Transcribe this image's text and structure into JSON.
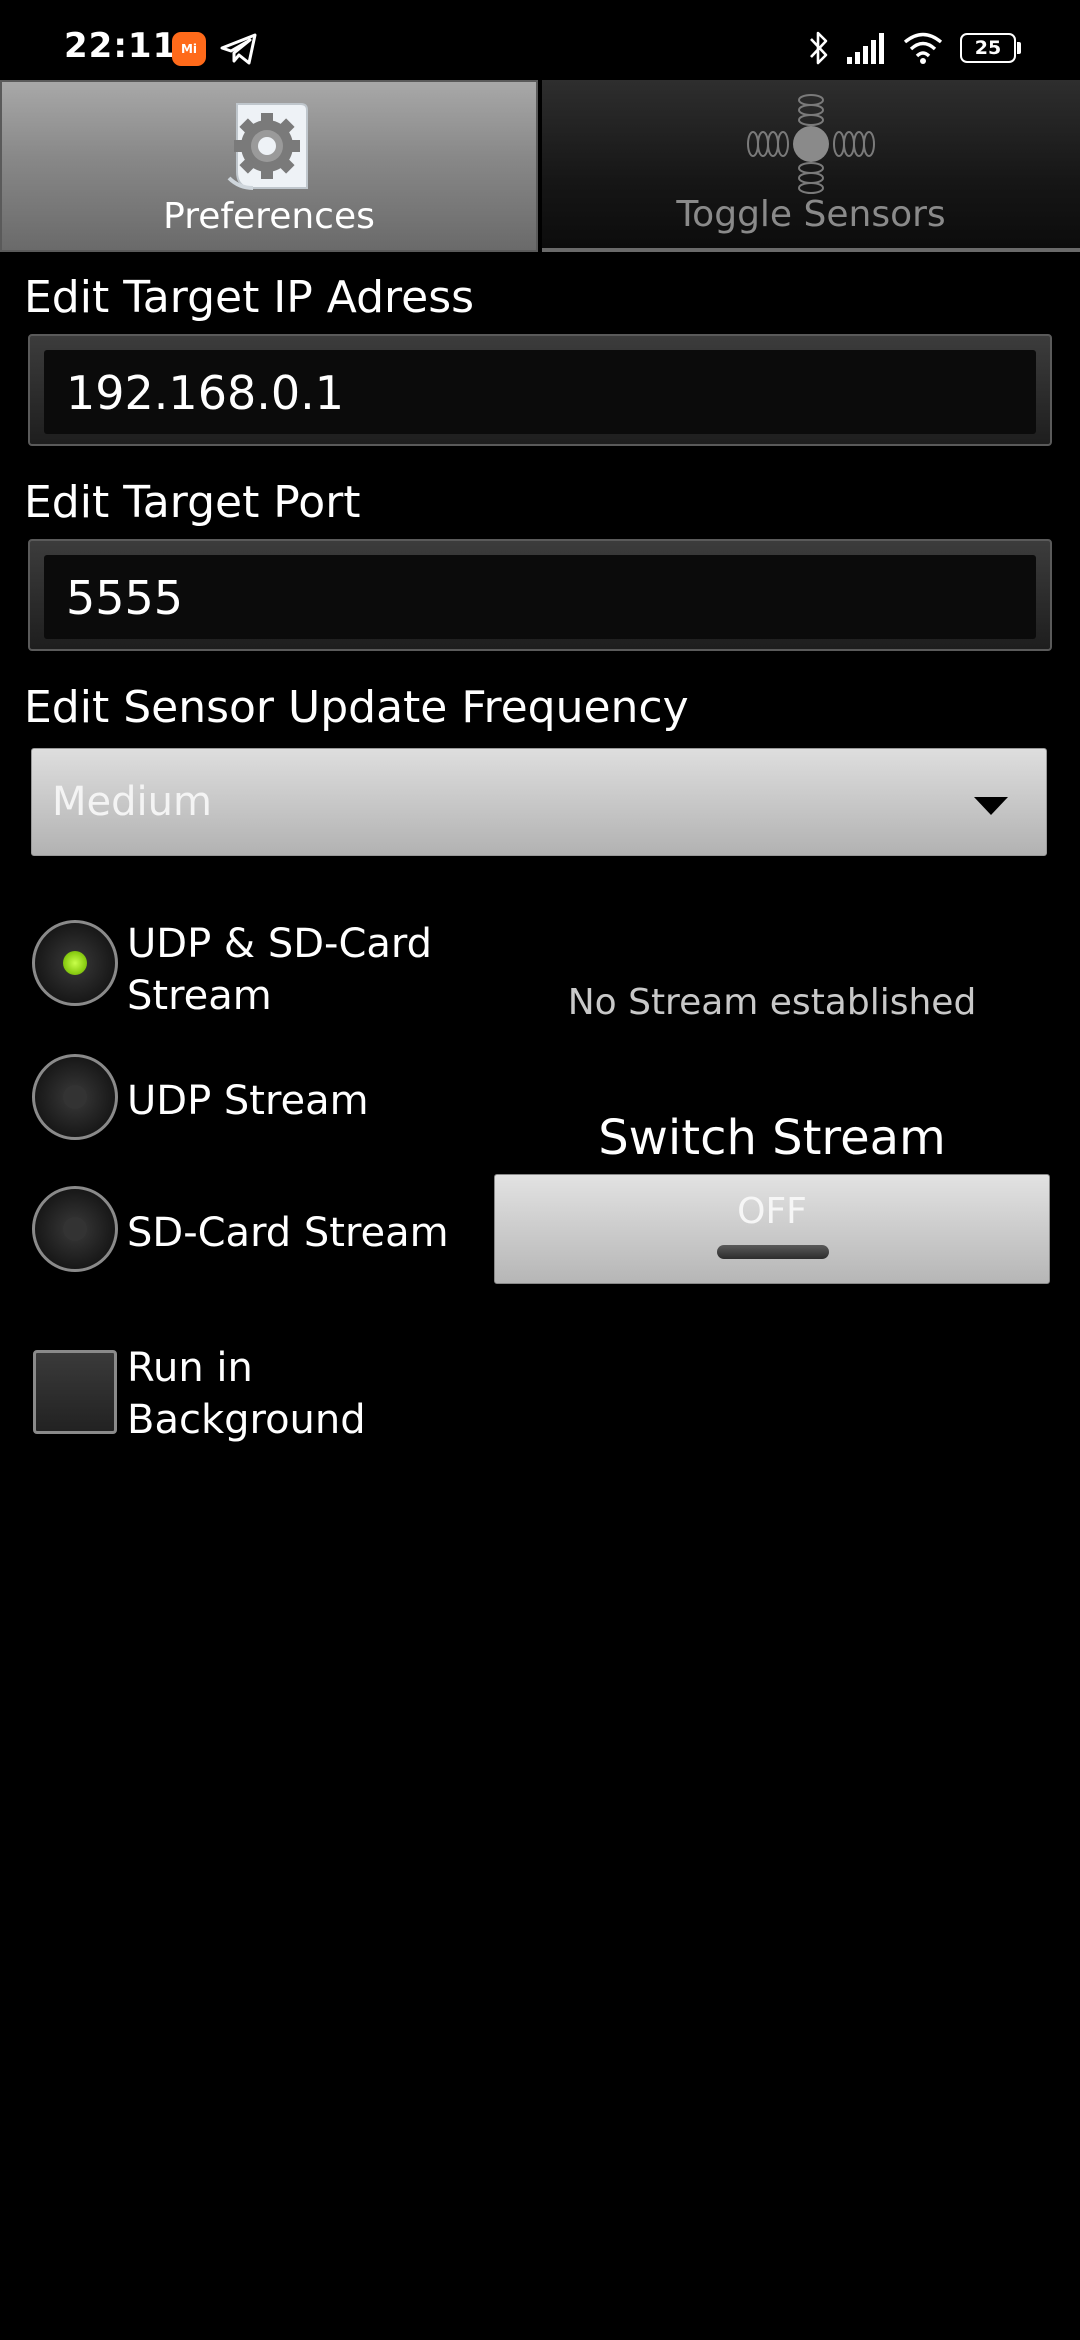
{
  "status_bar": {
    "time": "22:11",
    "mi_icon_text": "Mi",
    "battery": "25",
    "icons": [
      "mi-app-icon",
      "telegram-icon",
      "bluetooth-icon",
      "signal-icon",
      "wifi-icon",
      "battery-icon"
    ]
  },
  "tabs": [
    {
      "label": "Preferences",
      "icon": "gear-paper-icon",
      "selected": true
    },
    {
      "label": "Toggle Sensors",
      "icon": "sensor-axes-icon",
      "selected": false
    }
  ],
  "form": {
    "ip_label": "Edit Target IP Adress",
    "ip_value": "192.168.0.1",
    "port_label": "Edit Target Port",
    "port_value": "5555",
    "frequency_label": "Edit Sensor Update Frequency",
    "frequency_value": "Medium"
  },
  "stream_options": [
    {
      "label_line1": "UDP & SD-Card",
      "label_line2": "Stream",
      "checked": true
    },
    {
      "label_line1": "UDP Stream",
      "checked": false
    },
    {
      "label_line1": "SD-Card Stream",
      "checked": false
    }
  ],
  "stream": {
    "status": "No Stream established",
    "switch_title": "Switch Stream",
    "switch_state": "OFF"
  },
  "background": {
    "label_line1": "Run in",
    "label_line2": "Background",
    "checked": false
  },
  "colors": {
    "background": "#000000",
    "radio_active": "#8ccf14",
    "mi_badge": "#ff6a1a"
  }
}
